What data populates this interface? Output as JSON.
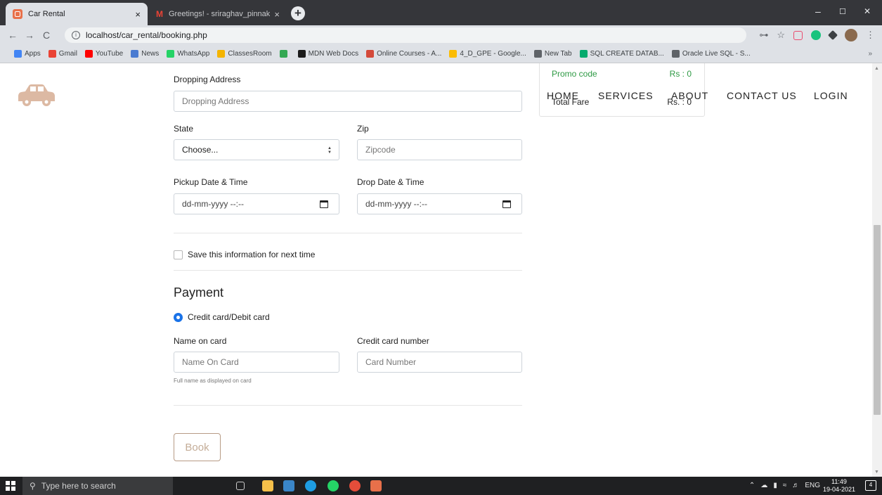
{
  "browser": {
    "tabs": [
      {
        "label": "Car Rental",
        "active": true
      },
      {
        "label": "Greetings! - sriraghav_pinnaka@",
        "active": false
      }
    ],
    "new_tab": "+",
    "close_glyph": "×",
    "window_controls": {
      "minimize": "–",
      "maximize": "☐",
      "close": "✕"
    },
    "nav": {
      "back": "←",
      "forward": "→",
      "reload": "C"
    },
    "url": "localhost/car_rental/booking.php",
    "info_glyph": "i",
    "toolbar_icons": {
      "key": "⊶",
      "star": "☆",
      "more": "⋮"
    },
    "bookmarks": [
      {
        "label": "Apps",
        "color": "#4285f4"
      },
      {
        "label": "Gmail",
        "color": "#ea4335"
      },
      {
        "label": "YouTube",
        "color": "#ff0000"
      },
      {
        "label": "News",
        "color": "#4a7bd1"
      },
      {
        "label": "WhatsApp",
        "color": "#25d366"
      },
      {
        "label": "ClassesRoom",
        "color": "#f4b400"
      },
      {
        "label": "",
        "color": "#34a853"
      },
      {
        "label": "MDN Web Docs",
        "color": "#1b1b1b"
      },
      {
        "label": "Online Courses - A...",
        "color": "#d44a3a"
      },
      {
        "label": "4_D_GPE - Google...",
        "color": "#fbbc04"
      },
      {
        "label": "New Tab",
        "color": "#5f6368"
      },
      {
        "label": "SQL CREATE DATAB...",
        "color": "#04aa6d"
      },
      {
        "label": "Oracle Live SQL - S...",
        "color": "#5f6368"
      }
    ],
    "bookmarks_more": "»"
  },
  "site": {
    "logo_icon": "car-icon",
    "logo_color": "#dcb9a3",
    "nav": [
      "HOME",
      "SERVICES",
      "ABOUT",
      "CONTACT US",
      "LOGIN"
    ]
  },
  "summary": {
    "promo_label": "Promo code",
    "promo_value": "Rs : 0",
    "total_label": "Total Fare",
    "total_value": "Rs. : 0"
  },
  "form": {
    "dropping_address": {
      "label": "Dropping Address",
      "placeholder": "Dropping Address"
    },
    "state": {
      "label": "State",
      "selected": "Choose..."
    },
    "zip": {
      "label": "Zip",
      "placeholder": "Zipcode"
    },
    "pickup": {
      "label": "Pickup Date & Time",
      "placeholder": "dd-mm-yyyy --:--"
    },
    "drop": {
      "label": "Drop Date & Time",
      "placeholder": "dd-mm-yyyy --:--"
    },
    "save_info": "Save this information for next time",
    "payment_heading": "Payment",
    "payment_method": "Credit card/Debit card",
    "name_on_card": {
      "label": "Name on card",
      "placeholder": "Name On Card",
      "help": "Full name as displayed on card"
    },
    "card_number": {
      "label": "Credit card number",
      "placeholder": "Card Number"
    },
    "book_button": "Book"
  },
  "taskbar": {
    "search_placeholder": "Type here to search",
    "time": "11:49",
    "date": "19-04-2021",
    "lang": "ENG",
    "notifications": "4"
  }
}
